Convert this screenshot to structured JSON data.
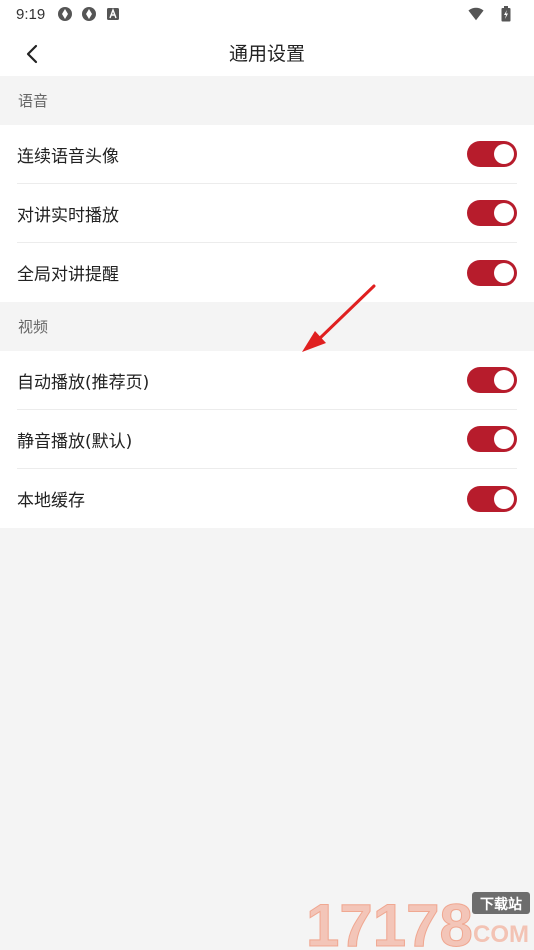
{
  "status_bar": {
    "time": "9:19",
    "left_icons": [
      "sync-icon",
      "sync-icon",
      "a-badge-icon"
    ],
    "right_icons": [
      "wifi-icon",
      "battery-icon"
    ]
  },
  "header": {
    "title": "通用设置",
    "back_icon": "chevron-left-icon"
  },
  "sections": [
    {
      "title": "语音",
      "items": [
        {
          "label": "连续语音头像",
          "enabled": true
        },
        {
          "label": "对讲实时播放",
          "enabled": true
        },
        {
          "label": "全局对讲提醒",
          "enabled": true
        }
      ]
    },
    {
      "title": "视频",
      "items": [
        {
          "label": "自动播放(推荐页)",
          "enabled": true
        },
        {
          "label": "静音播放(默认)",
          "enabled": true
        },
        {
          "label": "本地缓存",
          "enabled": true
        }
      ]
    }
  ],
  "colors": {
    "toggle_on": "#b71c2c",
    "background": "#f4f4f4",
    "annotation_arrow": "#e02020"
  },
  "watermark": {
    "number": "17178",
    "tag": "下载站",
    "suffix": "COM"
  }
}
